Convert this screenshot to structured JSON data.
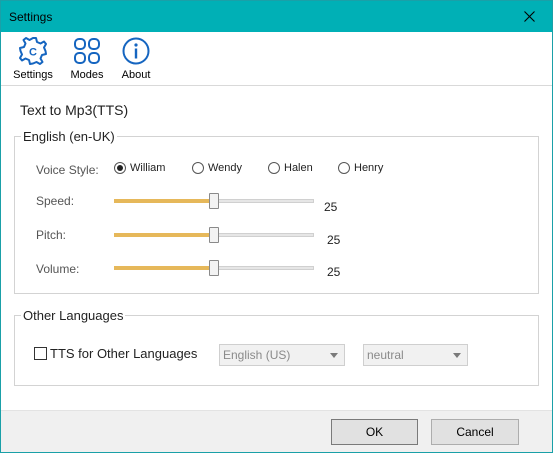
{
  "window": {
    "title": "Settings"
  },
  "toolbar": {
    "settings_label": "Settings",
    "modes_label": "Modes",
    "about_label": "About",
    "accent": "#1565c0"
  },
  "heading": "Text to Mp3(TTS)",
  "english_group": {
    "title": "English (en-UK)",
    "voice_style_label": "Voice Style:",
    "voices": [
      {
        "label": "William",
        "selected": true
      },
      {
        "label": "Wendy",
        "selected": false
      },
      {
        "label": "Halen",
        "selected": false
      },
      {
        "label": "Henry",
        "selected": false
      }
    ],
    "speed": {
      "label": "Speed:",
      "value": "25",
      "fraction": 0.5
    },
    "pitch": {
      "label": "Pitch:",
      "value": "25",
      "fraction": 0.5
    },
    "volume": {
      "label": "Volume:",
      "value": "25",
      "fraction": 0.5
    }
  },
  "other_group": {
    "title": "Other Languages",
    "checkbox_label": "TTS for Other Languages",
    "checked": false,
    "language_value": "English (US)",
    "style_value": "neutral"
  },
  "footer": {
    "ok_label": "OK",
    "cancel_label": "Cancel"
  },
  "colors": {
    "titlebar": "#00b0b6",
    "slider_fill": "#e6b85a"
  }
}
